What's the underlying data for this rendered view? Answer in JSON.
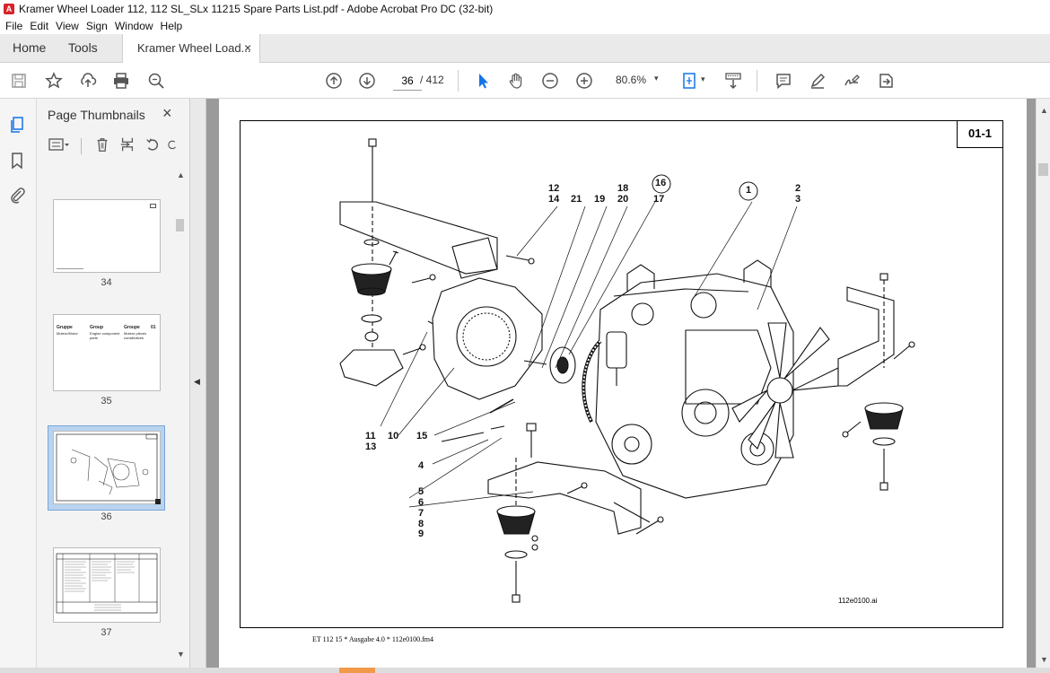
{
  "window": {
    "title": "Kramer Wheel Loader 112, 112 SL_SLx 11215 Spare Parts List.pdf - Adobe Acrobat Pro DC (32-bit)",
    "app_icon": "acrobat-icon"
  },
  "menu": [
    "File",
    "Edit",
    "View",
    "Sign",
    "Window",
    "Help"
  ],
  "tabs": {
    "home": "Home",
    "tools": "Tools",
    "document": "Kramer Wheel Load...",
    "close": "×"
  },
  "toolbar": {
    "page_current": "36",
    "page_total": "/ 412",
    "zoom": "80.6%",
    "zoom_arrow": "▾"
  },
  "panel": {
    "title": "Page Thumbnails",
    "close": "×",
    "thumbnails": [
      {
        "label": "34"
      },
      {
        "label": "35",
        "col1": "Gruppe",
        "col2": "Group",
        "col3": "Groupe",
        "num": "01",
        "sub1": "Moteur/Motor",
        "sub2": "Engine component parts",
        "sub3": "Moteur pièces constitutives"
      },
      {
        "label": "36",
        "selected": true
      },
      {
        "label": "37"
      }
    ]
  },
  "document": {
    "page_code": "01-1",
    "footer": "ET 112 15 * Ausgabe 4.0 * 112e0100.fm4",
    "file_name": "112e0100.ai",
    "callouts": {
      "c12": "12",
      "c14": "14",
      "c21": "21",
      "c19": "19",
      "c18": "18",
      "c20": "20",
      "c16": "16",
      "c17": "17",
      "c1": "1",
      "c2": "2",
      "c3": "3",
      "c11": "11",
      "c13": "13",
      "c10": "10",
      "c15": "15",
      "c4": "4",
      "c5": "5",
      "c6": "6",
      "c7": "7",
      "c8": "8",
      "c9": "9"
    }
  },
  "colors": {
    "accent": "#1473e6",
    "acrobat_red": "#d8232a",
    "viewer_bg": "#9a9a9a"
  }
}
